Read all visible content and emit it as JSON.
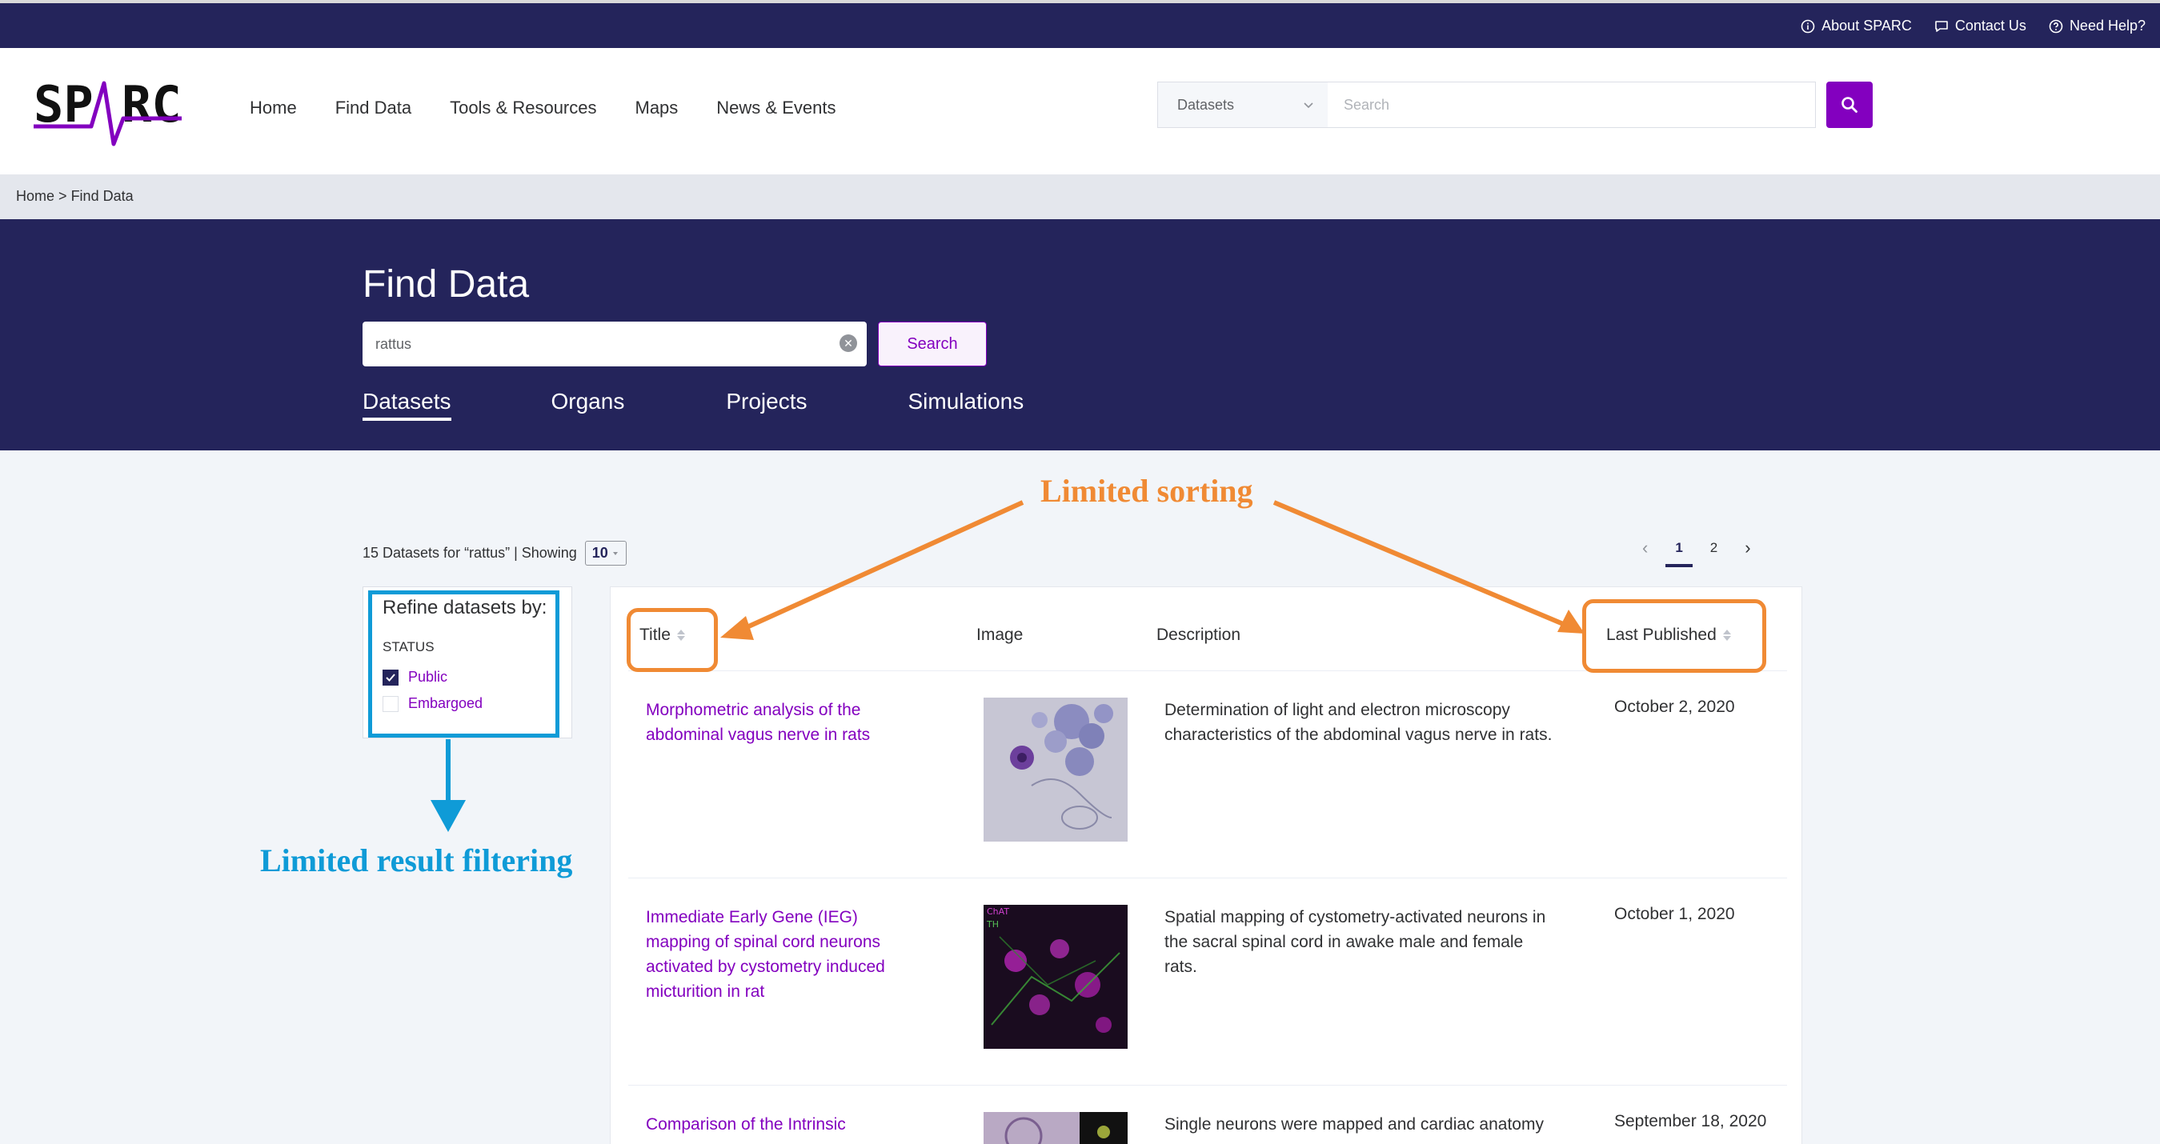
{
  "utility_bar": {
    "links": [
      {
        "label": "About SPARC",
        "icon": "info-icon"
      },
      {
        "label": "Contact Us",
        "icon": "chat-icon"
      },
      {
        "label": "Need Help?",
        "icon": "help-icon"
      }
    ]
  },
  "header": {
    "logo_text": "SPARC",
    "nav": [
      "Home",
      "Find Data",
      "Tools & Resources",
      "Maps",
      "News & Events"
    ],
    "search_type": "Datasets",
    "search_placeholder": "Search"
  },
  "breadcrumb": {
    "home": "Home",
    "separator": ">",
    "current": "Find Data"
  },
  "hero": {
    "title": "Find Data",
    "search_value": "rattus",
    "search_button": "Search",
    "tabs": [
      "Datasets",
      "Organs",
      "Projects",
      "Simulations"
    ],
    "active_tab": "Datasets"
  },
  "results": {
    "summary": "15 Datasets for “rattus” | Showing",
    "page_size": "10",
    "pages": [
      "1",
      "2"
    ],
    "current_page": "1"
  },
  "filter": {
    "title": "Refine datasets by:",
    "section": "STATUS",
    "options": [
      {
        "label": "Public",
        "checked": true
      },
      {
        "label": "Embargoed",
        "checked": false
      }
    ]
  },
  "table": {
    "headers": {
      "title": "Title",
      "image": "Image",
      "description": "Description",
      "last_published": "Last Published"
    },
    "rows": [
      {
        "title_lines": [
          "Morphometric analysis of the",
          "abdominal vagus nerve in rats"
        ],
        "desc_lines": [
          "Determination of light and electron microscopy",
          "characteristics of the abdominal vagus nerve in rats."
        ],
        "date": "October 2, 2020"
      },
      {
        "title_lines": [
          "Immediate Early Gene (IEG)",
          "mapping of spinal cord neurons",
          "activated by cystometry induced",
          "micturition in rat"
        ],
        "desc_lines": [
          "Spatial mapping of cystometry-activated neurons in",
          "the sacral spinal cord in awake male and female",
          "rats."
        ],
        "date": "October 1, 2020",
        "thumb_labels": [
          "ChAT",
          "TH"
        ]
      },
      {
        "title_lines": [
          "Comparison of the Intrinsic"
        ],
        "desc_lines": [
          "Single neurons were mapped and cardiac anatomy"
        ],
        "date": "September 18, 2020"
      }
    ]
  },
  "annotations": {
    "sorting": "Limited sorting",
    "filtering": "Limited result filtering"
  },
  "colors": {
    "navy": "#24245b",
    "purple": "#8300bf",
    "annotation_orange": "#f08a34",
    "annotation_blue": "#0f9bd7"
  }
}
